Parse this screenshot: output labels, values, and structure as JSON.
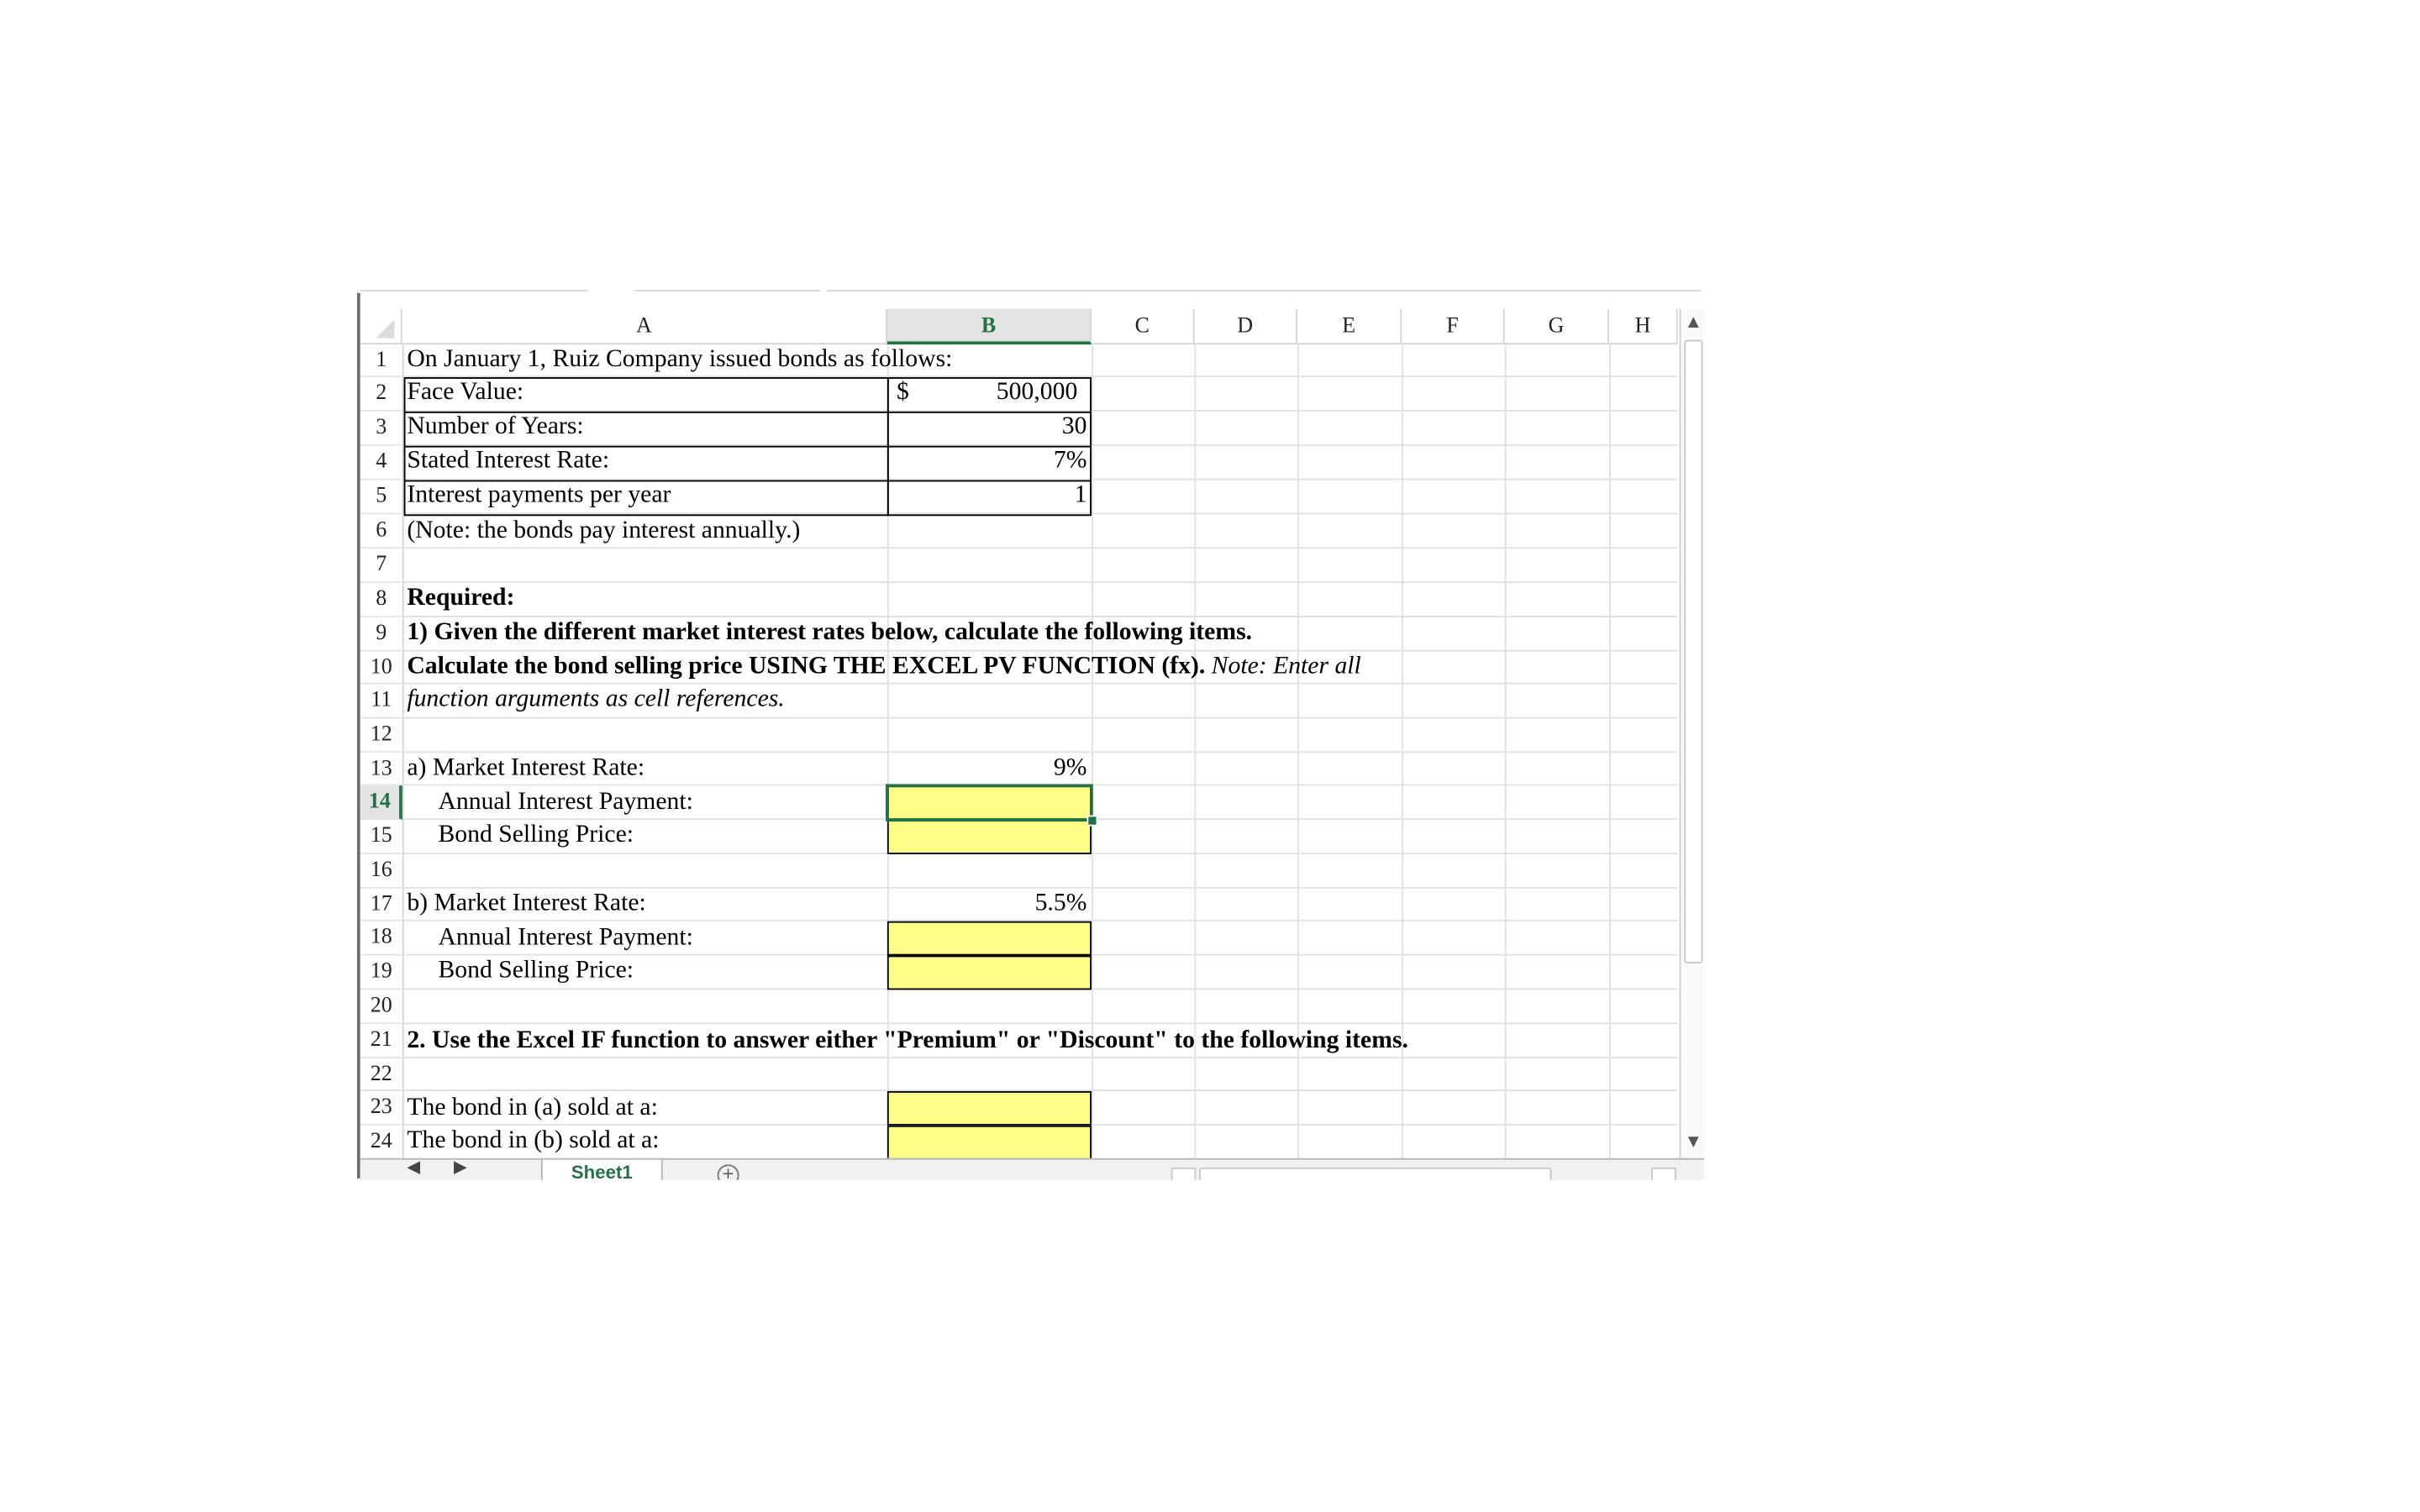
{
  "columns": [
    "A",
    "B",
    "C",
    "D",
    "E",
    "F",
    "G",
    "H"
  ],
  "selected_column": "B",
  "rows": [
    "1",
    "2",
    "3",
    "4",
    "5",
    "6",
    "7",
    "8",
    "9",
    "10",
    "11",
    "12",
    "13",
    "14",
    "15",
    "16",
    "17",
    "18",
    "19",
    "20",
    "21",
    "22",
    "23",
    "24"
  ],
  "selected_row": "14",
  "cells": {
    "A1": "On January 1,  Ruiz Company issued bonds as follows:",
    "A2": "Face Value:",
    "B2_currency": "$",
    "B2": "500,000",
    "A3": "Number of Years:",
    "B3": "30",
    "A4": "Stated Interest Rate:",
    "B4": "7%",
    "A5": "Interest payments per year",
    "B5": "1",
    "A6": "(Note: the bonds pay interest annually.)",
    "A8": "Required:",
    "A9": " 1) Given the different market interest rates below, calculate the following items.",
    "A10_bold": "Calculate the bond selling price USING THE EXCEL PV FUNCTION (fx).",
    "A10_italic": " Note: Enter all",
    "A11": "function arguments as cell references.",
    "A13": "a)  Market Interest Rate:",
    "B13": "9%",
    "A14": "Annual Interest Payment:",
    "A15": "Bond Selling Price:",
    "A17": "b)  Market Interest Rate:",
    "B17": "5.5%",
    "A18": "Annual Interest Payment:",
    "A19": "Bond Selling Price:",
    "A21": "2. Use the Excel IF function to answer either \"Premium\" or \"Discount\" to the following items.",
    "A23": "The bond in (a) sold at a:",
    "A24": "The bond in (b) sold at a:"
  },
  "input_cell_color": "#ffff88",
  "accent_color": "#217346",
  "sheet_tab": "Sheet1",
  "icons": {
    "scroll_up": "▲",
    "scroll_down": "▼",
    "prev_sheet": "◀",
    "next_sheet": "▶",
    "add_sheet": "+"
  }
}
